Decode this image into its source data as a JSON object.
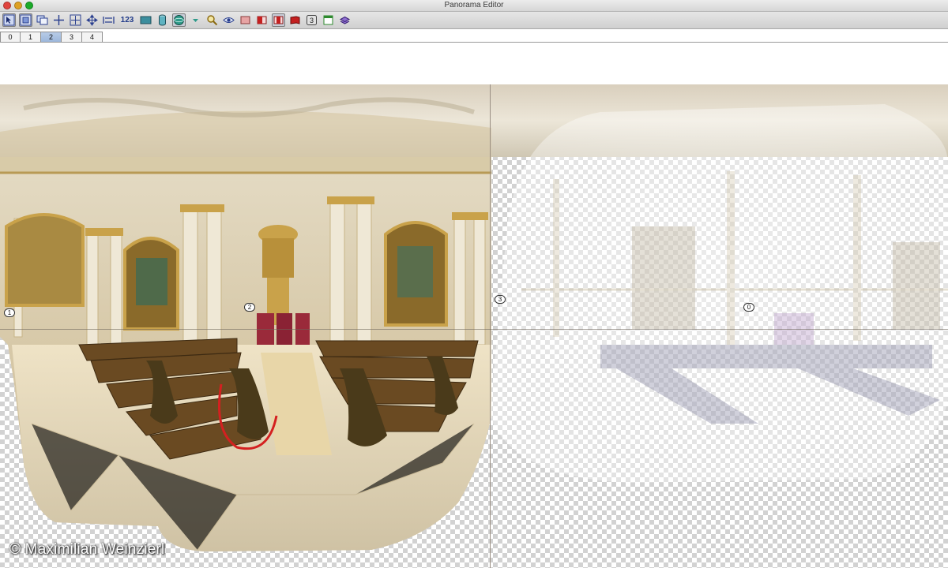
{
  "window": {
    "title": "Panorama Editor"
  },
  "toolbar": {
    "items": [
      {
        "icon": "select-image-icon"
      },
      {
        "icon": "select-point-icon"
      },
      {
        "icon": "copy-layers-icon"
      },
      {
        "icon": "crosshair-icon"
      },
      {
        "icon": "move-center-icon"
      },
      {
        "icon": "move-arrows-icon"
      },
      {
        "icon": "fit-width-icon"
      },
      {
        "icon": "numbering-icon",
        "label": "123"
      },
      {
        "icon": "image-rectangle-icon"
      },
      {
        "icon": "cylinder-icon"
      },
      {
        "icon": "sphere-icon"
      },
      {
        "icon": "dropdown-arrow-icon"
      },
      {
        "icon": "magnifier-icon"
      },
      {
        "icon": "eye-icon"
      },
      {
        "icon": "pink-layer-icon"
      },
      {
        "icon": "red-layer-left-icon"
      },
      {
        "icon": "red-layer-center-icon"
      },
      {
        "icon": "red-layer-right-icon"
      },
      {
        "icon": "number-box-icon",
        "label": "3"
      },
      {
        "icon": "window-icon"
      },
      {
        "icon": "stack-icon"
      }
    ]
  },
  "tabs": {
    "items": [
      "0",
      "1",
      "2",
      "3",
      "4"
    ],
    "active": "2"
  },
  "canvas": {
    "markers": [
      "1",
      "2",
      "3",
      "0"
    ]
  },
  "footer": {
    "copyright": "© Maximilian Weinzierl"
  },
  "colors": {
    "gold": "#c9a24a",
    "pew": "#6a4a22",
    "marble": "#e8dcc2",
    "ceiling": "#e8e4da"
  }
}
